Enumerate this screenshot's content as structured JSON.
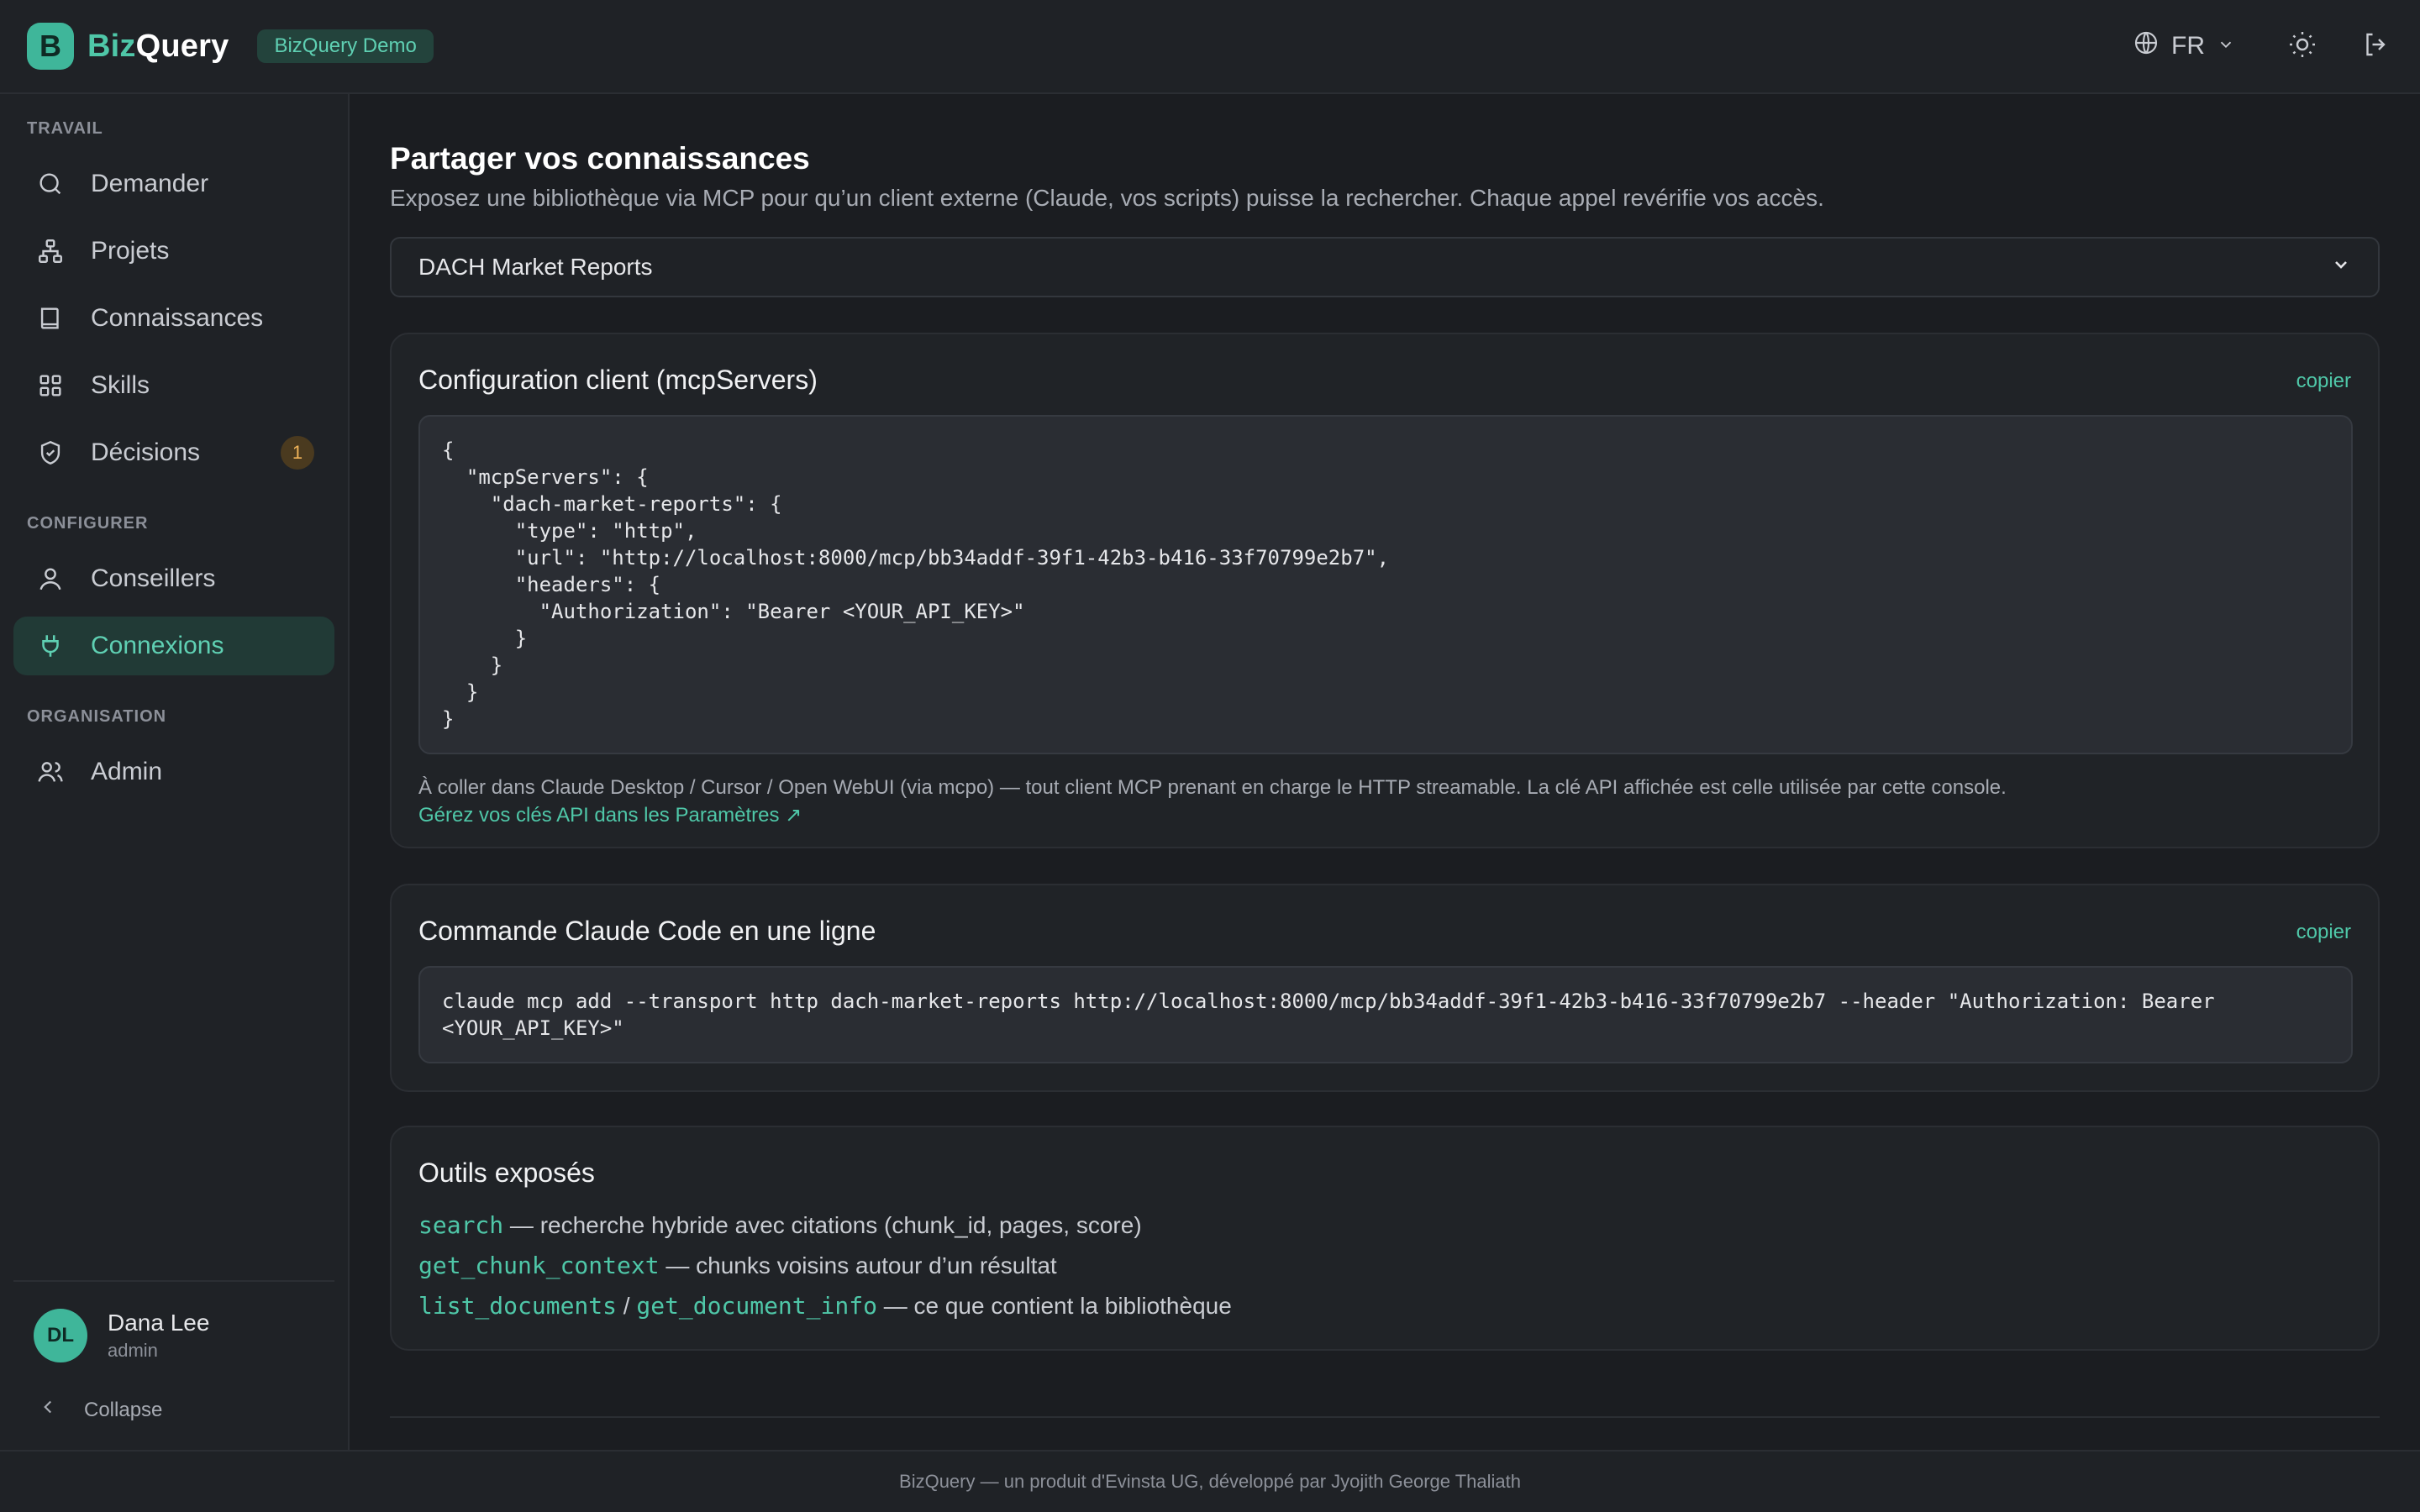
{
  "header": {
    "logo_letter": "B",
    "brand_prefix": "Biz",
    "brand_suffix": "Query",
    "demo_label": "BizQuery Demo",
    "language": "FR"
  },
  "sidebar": {
    "sections": {
      "work": "TRAVAIL",
      "configure": "CONFIGURER",
      "organisation": "ORGANISATION"
    },
    "items": [
      {
        "label": "Demander",
        "icon": "search-icon"
      },
      {
        "label": "Projets",
        "icon": "hierarchy-icon"
      },
      {
        "label": "Connaissances",
        "icon": "book-icon"
      },
      {
        "label": "Skills",
        "icon": "grid-icon"
      },
      {
        "label": "Décisions",
        "icon": "shield-check-icon",
        "badge": "1"
      },
      {
        "label": "Conseillers",
        "icon": "user-icon"
      },
      {
        "label": "Connexions",
        "icon": "plug-icon",
        "active": true
      },
      {
        "label": "Admin",
        "icon": "users-icon"
      }
    ],
    "user": {
      "initials": "DL",
      "name": "Dana Lee",
      "role": "admin"
    },
    "collapse_label": "Collapse"
  },
  "main": {
    "title": "Partager vos connaissances",
    "subtitle": "Exposez une bibliothèque via MCP pour qu’un client externe (Claude, vos scripts) puisse la rechercher. Chaque appel revérifie vos accès.",
    "library_select": "DACH Market Reports",
    "config_card": {
      "title": "Configuration client (mcpServers)",
      "copy_label": "copier",
      "code": "{\n  \"mcpServers\": {\n    \"dach-market-reports\": {\n      \"type\": \"http\",\n      \"url\": \"http://localhost:8000/mcp/bb34addf-39f1-42b3-b416-33f70799e2b7\",\n      \"headers\": {\n        \"Authorization\": \"Bearer <YOUR_API_KEY>\"\n      }\n    }\n  }\n}",
      "note": "À coller dans Claude Desktop / Cursor / Open WebUI (via mcpo) — tout client MCP prenant en charge le HTTP streamable. La clé API affichée est celle utilisée par cette console.",
      "settings_link": "Gérez vos clés API dans les Paramètres ↗"
    },
    "command_card": {
      "title": "Commande Claude Code en une ligne",
      "copy_label": "copier",
      "code": "claude mcp add --transport http dach-market-reports http://localhost:8000/mcp/bb34addf-39f1-42b3-b416-33f70799e2b7 --header \"Authorization: Bearer\n<YOUR_API_KEY>\""
    },
    "tools_card": {
      "title": "Outils exposés",
      "tools": [
        {
          "name": "search",
          "desc": " — recherche hybride avec citations (chunk_id, pages, score)"
        },
        {
          "name": "get_chunk_context",
          "desc": " — chunks voisins autour d’un résultat"
        },
        {
          "name": "list_documents",
          "sep": " / ",
          "name2": "get_document_info",
          "desc": " — ce que contient la bibliothèque"
        }
      ]
    }
  },
  "footer": {
    "text": "BizQuery — un produit d'Evinsta UG, développé par Jyojith George Thaliath"
  },
  "colors": {
    "accent": "#4fc7a8",
    "background": "#1b1d21",
    "panel": "#1f2226",
    "badge": "#f0b45a"
  }
}
